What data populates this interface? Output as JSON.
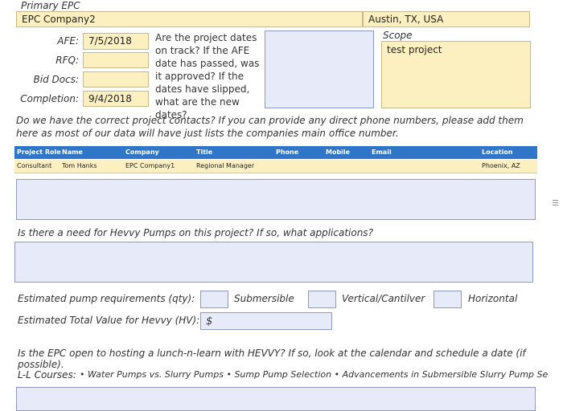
{
  "epc": {
    "label": "Primary EPC",
    "company": "EPC Company2",
    "location": "Austin, TX, USA"
  },
  "dates": {
    "afe_label": "AFE:",
    "afe_value": "7/5/2018",
    "rfq_label": "RFQ:",
    "rfq_value": "",
    "bid_label": "Bid Docs:",
    "bid_value": "",
    "completion_label": "Completion:",
    "completion_value": "9/4/2018",
    "question": "Are the project dates on track? If the AFE date has passed, was it approved? If the dates have slipped, what are the new dates?"
  },
  "scope": {
    "label": "Scope",
    "value": "test project"
  },
  "contacts": {
    "question": "Do we have the correct project contacts? If you can provide any direct phone numbers, please add them here as most of our data will have just lists the companies main office number.",
    "columns": [
      "Project Role",
      "Name",
      "Company",
      "Title",
      "Phone",
      "Mobile",
      "Email",
      "Location"
    ],
    "rows": [
      [
        "Consultant",
        "Tom Hanks",
        "EPC Company1",
        "Regional Manager",
        "",
        "",
        "",
        "Phoenix, AZ"
      ]
    ]
  },
  "pumps": {
    "question": "Is there a need for Hevvy Pumps on this project? If so, what applications?",
    "estimated_label": "Estimated pump requirements (qty):",
    "submersible_label": "Submersible",
    "vertical_label": "Vertical/Cantilver",
    "horizontal_label": "Horizontal",
    "total_label": "Estimated Total Value for Hevvy (HV):",
    "total_value": "$"
  },
  "lunch": {
    "question": "Is the EPC open to hosting a lunch-n-learn with HEVVY? If so, look at the calendar and schedule a date (if possible).",
    "courses_label": "L-L Courses:",
    "courses": "• Water Pumps vs. Slurry Pumps • Sump Pump Selection • Advancements in Submersible Slurry Pump Seals"
  }
}
